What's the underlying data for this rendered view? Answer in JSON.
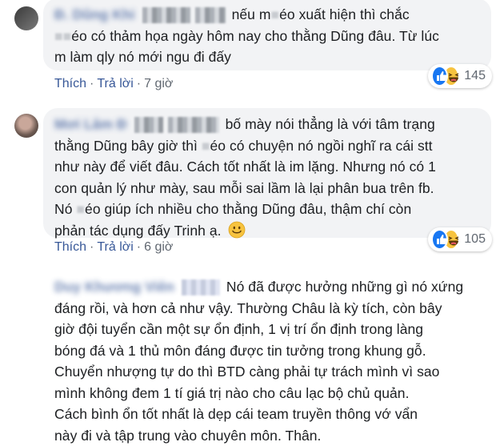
{
  "comments": [
    {
      "author": "Đ. Dũng Khi",
      "text_line1": "nếu m",
      "text_line1_b": "éo xuất hiện thì chắc",
      "text_line2_a": "",
      "text_line2_b": "éo có thảm họa ngày hôm nay cho thằng Dũng đâu. Từ lúc",
      "text_line3": "m làm qly nó mới ngu đi đấy",
      "like_label": "Thích",
      "reply_label": "Trả lời",
      "time": "7 giờ",
      "reaction_count": "145"
    },
    {
      "author": "Mơi Lâm Đ",
      "text_line1": "bố mày nói thẳng là với tâm trạng",
      "text_line2_a": "thằng Dũng bây giờ thì",
      "text_line2_b": "éo có chuyện nó ngồi nghĩ ra cái stt",
      "text_line3": "như này để viết đâu. Cách tốt nhất là im lặng.",
      "text_line4": "Nhưng nó có 1",
      "text_line5": "con quản lý như mày, sau mỗi sai lầm là lại phân bua trên fb.",
      "text_line6_a": "Nó",
      "text_line6_b": "éo giúp ích nhiều cho thằng Dũng đâu, thậm chí còn",
      "text_line7": "phản tác dụng đấy Trinh ạ.",
      "like_label": "Thích",
      "reply_label": "Trả lời",
      "time": "6 giờ",
      "reaction_count": "105"
    },
    {
      "author": "Duy Khương Viên",
      "text_line1": "Nó đã được hưởng những gì nó xứng",
      "text_line2": "đáng rồi, và hơn cả như vậy. Thường Châu là kỳ tích, còn bây",
      "text_line3": "giờ đội tuyển cần một sự ổn định, 1 vị trí ổn định trong làng",
      "text_line4": "bóng đá và 1 thủ môn đáng được tin tưởng trong khung gỗ.",
      "text_line5": "Chuyển nhượng tự do thì BTD càng phải tự trách mình vì sao",
      "text_line6": "mình không đem 1 tí giá trị nào cho câu lạc bộ chủ quản.",
      "text_line7": "Cách bình ổn tốt nhất là dẹp cái team truyền thông vớ vẩn",
      "text_line8": "này đi và tập trung vào chuyên môn. Thân."
    }
  ],
  "icons": {
    "like": "like-reaction-icon",
    "haha": "haha-reaction-icon",
    "smile": "smile-emoji-icon"
  },
  "colors": {
    "link": "#385898",
    "bubble": "#f2f3f5",
    "like": "#1877f2",
    "haha": "#f7c33f"
  }
}
